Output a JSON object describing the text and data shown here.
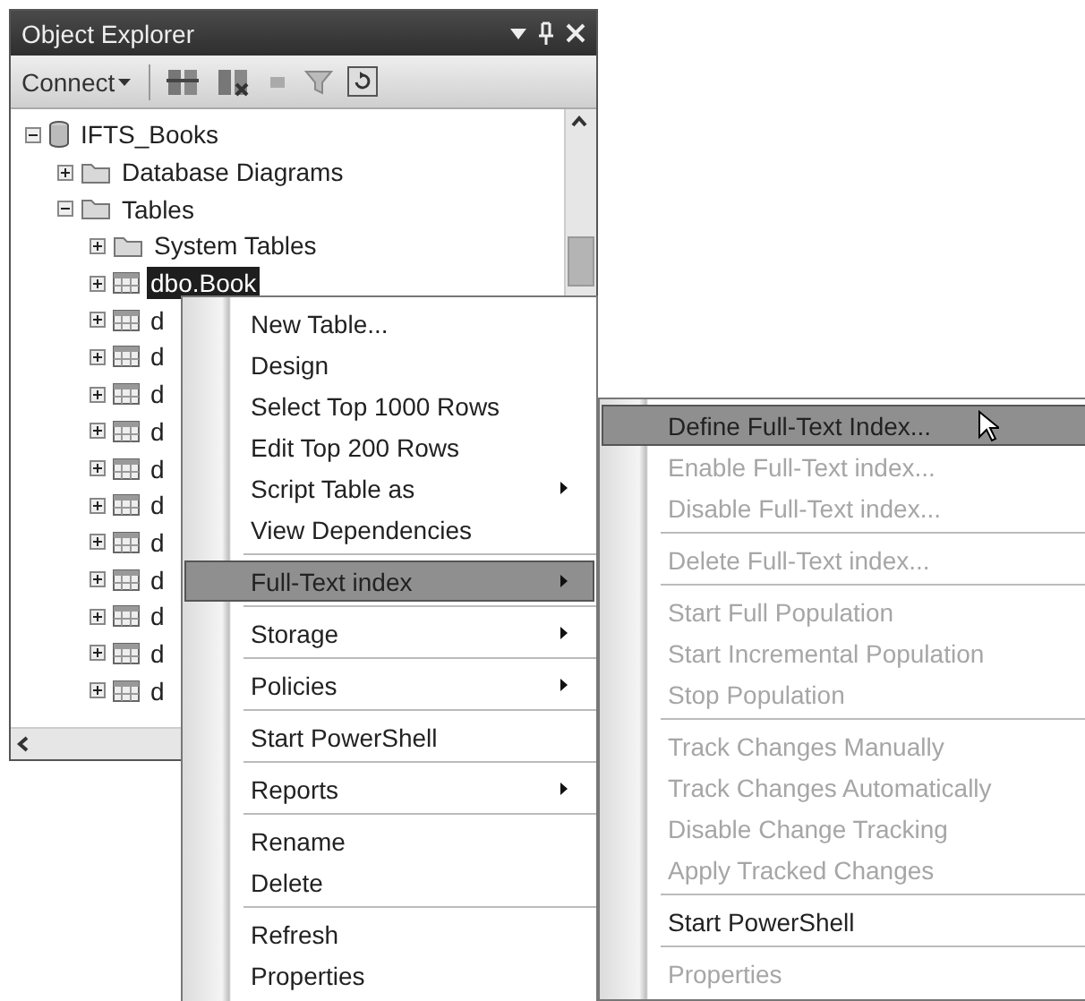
{
  "panel": {
    "title": "Object Explorer",
    "toolbar": {
      "connect": "Connect"
    }
  },
  "tree": [
    {
      "label": "IFTS_Books",
      "kind": "database",
      "expanded": true,
      "selected": false,
      "children": [
        {
          "label": "Database Diagrams",
          "kind": "folder",
          "expanded": false,
          "selected": false
        },
        {
          "label": "Tables",
          "kind": "folder",
          "expanded": true,
          "selected": false,
          "children": [
            {
              "label": "System Tables",
              "kind": "folder",
              "expanded": false,
              "selected": false
            },
            {
              "label": "dbo.Book",
              "kind": "table",
              "expanded": false,
              "selected": true
            },
            {
              "label": "d",
              "kind": "table",
              "expanded": false,
              "selected": false
            },
            {
              "label": "d",
              "kind": "table",
              "expanded": false,
              "selected": false
            },
            {
              "label": "d",
              "kind": "table",
              "expanded": false,
              "selected": false
            },
            {
              "label": "d",
              "kind": "table",
              "expanded": false,
              "selected": false
            },
            {
              "label": "d",
              "kind": "table",
              "expanded": false,
              "selected": false
            },
            {
              "label": "d",
              "kind": "table",
              "expanded": false,
              "selected": false
            },
            {
              "label": "d",
              "kind": "table",
              "expanded": false,
              "selected": false
            },
            {
              "label": "d",
              "kind": "table",
              "expanded": false,
              "selected": false
            },
            {
              "label": "d",
              "kind": "table",
              "expanded": false,
              "selected": false
            },
            {
              "label": "d",
              "kind": "table",
              "expanded": false,
              "selected": false
            },
            {
              "label": "d",
              "kind": "table",
              "expanded": false,
              "selected": false
            }
          ]
        }
      ]
    }
  ],
  "context_menu": {
    "groups": [
      [
        {
          "label": "New Table...",
          "submenu": false,
          "selected": false,
          "disabled": false
        },
        {
          "label": "Design",
          "submenu": false,
          "selected": false,
          "disabled": false
        },
        {
          "label": "Select Top 1000 Rows",
          "submenu": false,
          "selected": false,
          "disabled": false
        },
        {
          "label": "Edit Top 200 Rows",
          "submenu": false,
          "selected": false,
          "disabled": false
        },
        {
          "label": "Script Table as",
          "submenu": true,
          "selected": false,
          "disabled": false
        },
        {
          "label": "View Dependencies",
          "submenu": false,
          "selected": false,
          "disabled": false
        }
      ],
      [
        {
          "label": "Full-Text index",
          "submenu": true,
          "selected": true,
          "disabled": false
        }
      ],
      [
        {
          "label": "Storage",
          "submenu": true,
          "selected": false,
          "disabled": false
        }
      ],
      [
        {
          "label": "Policies",
          "submenu": true,
          "selected": false,
          "disabled": false
        }
      ],
      [
        {
          "label": "Start PowerShell",
          "submenu": false,
          "selected": false,
          "disabled": false
        }
      ],
      [
        {
          "label": "Reports",
          "submenu": true,
          "selected": false,
          "disabled": false
        }
      ],
      [
        {
          "label": "Rename",
          "submenu": false,
          "selected": false,
          "disabled": false
        },
        {
          "label": "Delete",
          "submenu": false,
          "selected": false,
          "disabled": false
        }
      ],
      [
        {
          "label": "Refresh",
          "submenu": false,
          "selected": false,
          "disabled": false
        },
        {
          "label": "Properties",
          "submenu": false,
          "selected": false,
          "disabled": false
        }
      ]
    ]
  },
  "submenu": {
    "groups": [
      [
        {
          "label": "Define Full-Text Index...",
          "submenu": false,
          "selected": true,
          "disabled": false
        },
        {
          "label": "Enable Full-Text index...",
          "submenu": false,
          "selected": false,
          "disabled": true
        },
        {
          "label": "Disable Full-Text index...",
          "submenu": false,
          "selected": false,
          "disabled": true
        }
      ],
      [
        {
          "label": "Delete Full-Text index...",
          "submenu": false,
          "selected": false,
          "disabled": true
        }
      ],
      [
        {
          "label": "Start Full Population",
          "submenu": false,
          "selected": false,
          "disabled": true
        },
        {
          "label": "Start Incremental Population",
          "submenu": false,
          "selected": false,
          "disabled": true
        },
        {
          "label": "Stop Population",
          "submenu": false,
          "selected": false,
          "disabled": true
        }
      ],
      [
        {
          "label": "Track Changes Manually",
          "submenu": false,
          "selected": false,
          "disabled": true
        },
        {
          "label": "Track Changes Automatically",
          "submenu": false,
          "selected": false,
          "disabled": true
        },
        {
          "label": "Disable Change Tracking",
          "submenu": false,
          "selected": false,
          "disabled": true
        },
        {
          "label": "Apply Tracked Changes",
          "submenu": false,
          "selected": false,
          "disabled": true
        }
      ],
      [
        {
          "label": "Start PowerShell",
          "submenu": false,
          "selected": false,
          "disabled": false
        }
      ],
      [
        {
          "label": "Properties",
          "submenu": false,
          "selected": false,
          "disabled": true
        }
      ]
    ]
  }
}
